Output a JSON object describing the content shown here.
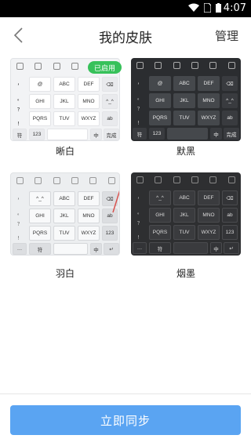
{
  "status_bar": {
    "time": "4:07"
  },
  "header": {
    "title": "我的皮肤",
    "manage_label": "管理"
  },
  "badge": {
    "label": "已启用"
  },
  "keys": {
    "row1": [
      "@",
      "ABC",
      "DEF"
    ],
    "row2": [
      "GHI",
      "JKL",
      "MNO"
    ],
    "row3": [
      "PQRS",
      "TUV",
      "WXYZ"
    ],
    "alt_row1": [
      "^_^",
      "ABC",
      "DEF"
    ],
    "side": [
      "，",
      "。",
      "？",
      "！"
    ],
    "right": [
      "⌫",
      "^_^",
      "ab"
    ],
    "right_alt": [
      "⌫",
      "ab",
      "123"
    ],
    "bottom": [
      "符",
      "123",
      "中",
      "完成"
    ],
    "bottom_alt": [
      "…",
      "符",
      "中",
      "↵"
    ]
  },
  "skins": [
    {
      "name": "晰白"
    },
    {
      "name": "默黑"
    },
    {
      "name": "羽白"
    },
    {
      "name": "烟墨"
    }
  ],
  "footer": {
    "sync_label": "立即同步"
  },
  "colors": {
    "accent": "#5aa4f2",
    "badge": "#37c15a"
  }
}
